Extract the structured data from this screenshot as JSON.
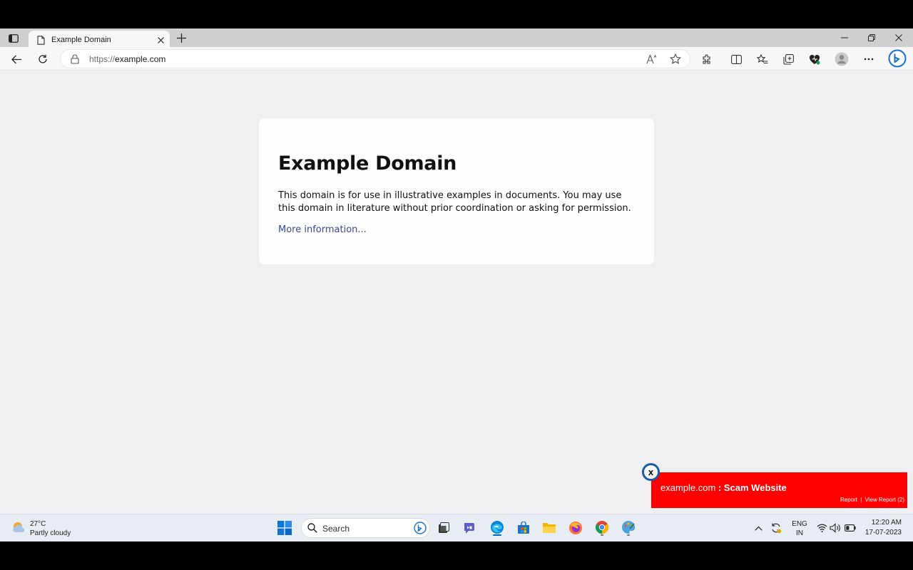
{
  "browser": {
    "tab_title": "Example Domain",
    "new_tab_symbol": "+",
    "url_protocol": "https://",
    "url_host": "example.com"
  },
  "page": {
    "heading": "Example Domain",
    "paragraph": "This domain is for use in illustrative examples in documents. You may use this domain in literature without prior coordination or asking for permission.",
    "link": "More information..."
  },
  "scam_popup": {
    "close_label": "x",
    "domain": "example.com",
    "separator": " : ",
    "verdict": "Scam Website",
    "report_label": "Report",
    "link_separator": "|",
    "view_report_label": "View Report (2)"
  },
  "taskbar": {
    "temperature": "27°C",
    "weather": "Partly cloudy",
    "search_placeholder": "Search",
    "language_primary": "ENG",
    "language_secondary": "IN",
    "time": "12:20 AM",
    "date": "17-07-2023"
  },
  "colors": {
    "scam_red": "#fe0000",
    "link_blue": "#38488f",
    "edge_accent": "#0067c0"
  },
  "icons": [
    "tab-actions-icon",
    "page-icon",
    "close-icon",
    "plus-icon",
    "minimize-icon",
    "restore-icon",
    "back-icon",
    "refresh-icon",
    "lock-icon",
    "read-aloud-icon",
    "favorite-star-icon",
    "extensions-icon",
    "split-screen-icon",
    "favorites-icon",
    "collections-icon",
    "browser-essentials-icon",
    "profile-icon",
    "more-icon",
    "bing-copilot-icon",
    "weather-icon",
    "windows-start-icon",
    "search-icon",
    "task-view-icon",
    "teams-icon",
    "edge-icon",
    "store-icon",
    "file-explorer-icon",
    "firefox-icon",
    "chrome-icon",
    "paint-icon",
    "chevron-up-icon",
    "sync-icon",
    "wifi-icon",
    "volume-icon",
    "battery-icon"
  ]
}
